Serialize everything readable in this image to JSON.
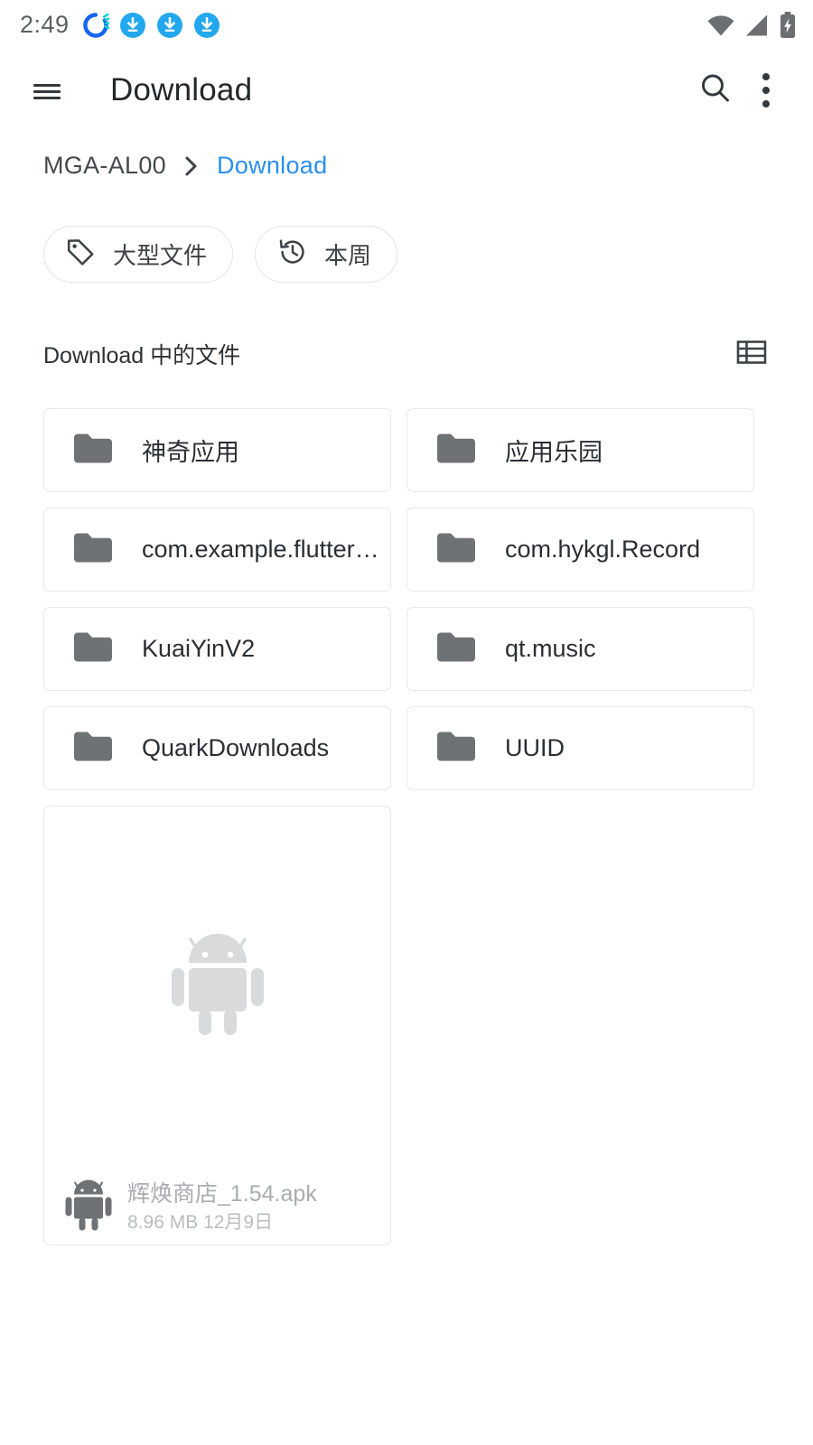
{
  "statusbar": {
    "time": "2:49",
    "left_icons": [
      "sync-spinner-icon",
      "download-circle-icon",
      "download-circle-icon",
      "download-circle-icon"
    ],
    "right_icons": [
      "wifi-icon",
      "cellular-signal-icon",
      "battery-charging-icon"
    ],
    "accent_blue": "#22a8ee",
    "spinner_blue": "#1565f0",
    "spinner_teal": "#17d6cf",
    "icon_gray": "#6b6f72"
  },
  "appbar": {
    "menu_icon": "hamburger-menu-icon",
    "title": "Download",
    "search_icon": "search-icon",
    "overflow_icon": "more-vertical-icon"
  },
  "breadcrumb": {
    "root": "MGA-AL00",
    "separator_icon": "chevron-right-icon",
    "current": "Download",
    "current_color": "#2a8ff0"
  },
  "chips": [
    {
      "label": "大型文件",
      "icon": "tag-icon"
    },
    {
      "label": "本周",
      "icon": "history-clock-icon"
    }
  ],
  "section": {
    "title": "Download 中的文件",
    "view_toggle_icon": "list-view-icon"
  },
  "folders": [
    {
      "name": "神奇应用",
      "icon": "folder-icon"
    },
    {
      "name": "应用乐园",
      "icon": "folder-icon"
    },
    {
      "name": "com.example.flutter…",
      "icon": "folder-icon"
    },
    {
      "name": "com.hykgl.Record",
      "icon": "folder-icon"
    },
    {
      "name": "KuaiYinV2",
      "icon": "folder-icon"
    },
    {
      "name": "qt.music",
      "icon": "folder-icon"
    },
    {
      "name": "QuarkDownloads",
      "icon": "folder-icon"
    },
    {
      "name": "UUID",
      "icon": "folder-icon"
    }
  ],
  "files": [
    {
      "name": "辉焕商店_1.54.apk",
      "size": "8.96 MB",
      "date": "12月9日",
      "subtitle": "8.96 MB  12月9日",
      "thumb_icon": "android-robot-icon",
      "type_icon": "android-robot-icon"
    }
  ]
}
